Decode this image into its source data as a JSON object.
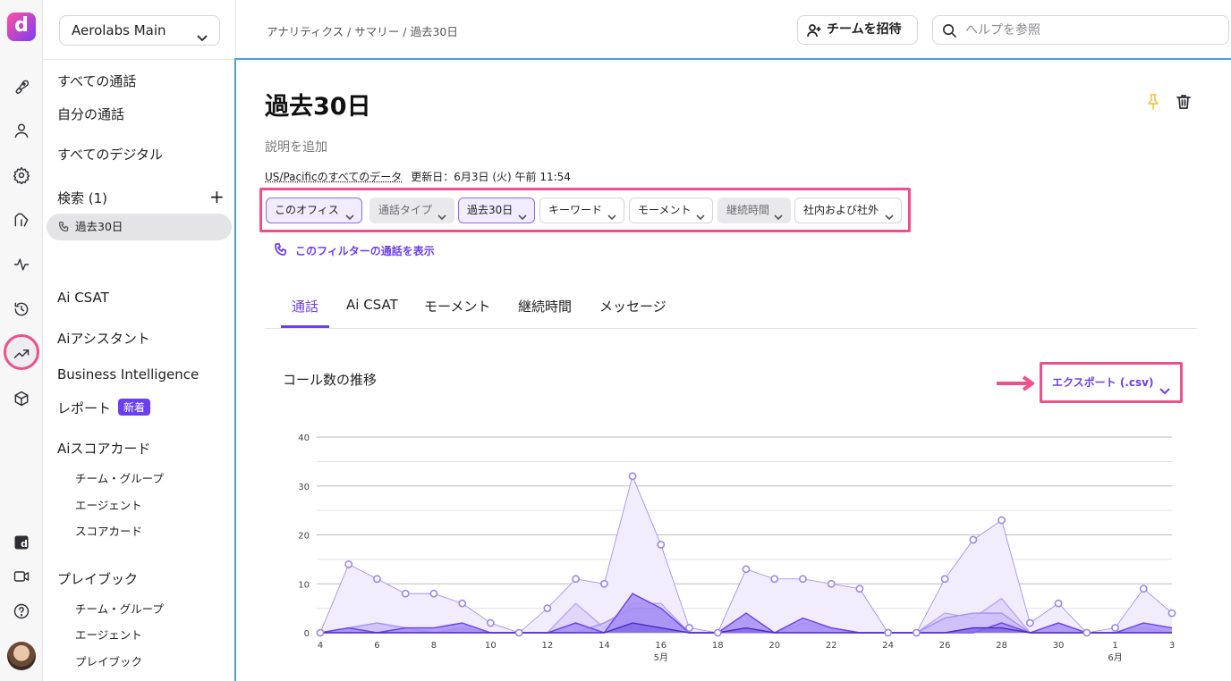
{
  "rail": {
    "logo_letter": "d",
    "icons": [
      "rocket-icon",
      "user-icon",
      "gear-icon",
      "route-icon",
      "activity-icon",
      "history-icon",
      "trending-up-icon",
      "cube-icon",
      "dialpad-logo-icon",
      "video-icon",
      "help-icon",
      "avatar"
    ]
  },
  "sidebar": {
    "workspace": "Aerolabs Main",
    "items": {
      "all_calls": "すべての通話",
      "my_calls": "自分の通話",
      "all_digital": "すべてのデジタル",
      "search": "検索 (1)",
      "saved_search": "過去30日",
      "ai_csat": "Ai CSAT",
      "ai_assistant": "Aiアシスタント",
      "bi": "Business Intelligence",
      "reports": "レポート",
      "reports_badge": "新着",
      "ai_scorecard": "Aiスコアカード",
      "scorecard_team": "チーム・グループ",
      "scorecard_agent": "エージェント",
      "scorecard_card": "スコアカード",
      "playbook": "プレイブック",
      "playbook_team": "チーム・グループ",
      "playbook_agent": "エージェント",
      "playbook_playbook": "プレイブック"
    }
  },
  "topbar": {
    "breadcrumb": "アナリティクス / サマリー / 過去30日",
    "invite_label": "チームを招待",
    "help_placeholder": "ヘルプを参照"
  },
  "main": {
    "title": "過去30日",
    "description": "説明を追加",
    "timezone": "US/Pacificのすべてのデータ",
    "updated": "更新日：6月3日 (火) 午前 11:54",
    "filters": [
      {
        "label": "このオフィス",
        "state": "selected"
      },
      {
        "label": "通話タイプ",
        "state": "disabled"
      },
      {
        "label": "過去30日",
        "state": "selected"
      },
      {
        "label": "キーワード",
        "state": "normal"
      },
      {
        "label": "モーメント",
        "state": "normal"
      },
      {
        "label": "継続時間",
        "state": "disabled"
      },
      {
        "label": "社内および社外",
        "state": "normal"
      }
    ],
    "show_calls": "このフィルターの通話を表示",
    "tabs": [
      "通話",
      "Ai CSAT",
      "モーメント",
      "継続時間",
      "メッセージ"
    ],
    "active_tab": 0,
    "chart_title": "コール数の推移",
    "export_label": "エクスポート (.csv)"
  },
  "colors": {
    "accent": "#6b3ff0",
    "highlight": "#f0508a",
    "pin": "#f2c84b"
  },
  "chart_data": {
    "type": "area",
    "x": [
      "4",
      "5",
      "6",
      "7",
      "8",
      "9",
      "10",
      "11",
      "12",
      "13",
      "14",
      "15",
      "16",
      "17",
      "18",
      "19",
      "20",
      "21",
      "22",
      "23",
      "24",
      "25",
      "26",
      "27",
      "28",
      "29",
      "30",
      "31",
      "1",
      "2",
      "3"
    ],
    "x_tick_labels": [
      "4",
      "6",
      "8",
      "10",
      "12",
      "14",
      "16",
      "18",
      "20",
      "22",
      "24",
      "26",
      "28",
      "30",
      "1",
      "3"
    ],
    "month_labels": [
      {
        "at": "16",
        "label": "5月"
      },
      {
        "at": "1",
        "label": "6月"
      }
    ],
    "ylim": [
      0,
      40
    ],
    "yticks": [
      0,
      10,
      20,
      30,
      40
    ],
    "grid": true,
    "series": [
      {
        "values": [
          0,
          14,
          11,
          8,
          8,
          6,
          2,
          0,
          5,
          11,
          10,
          32,
          18,
          1,
          0,
          13,
          11,
          11,
          10,
          9,
          0,
          0,
          11,
          19,
          23,
          2,
          6,
          0,
          1,
          9,
          4
        ],
        "color": "#9b86ee",
        "fill": "#f1edfd"
      },
      {
        "values": [
          0,
          0,
          0,
          0,
          0,
          0,
          0,
          0,
          0,
          6,
          1,
          6,
          6,
          0,
          0,
          0,
          0,
          0,
          0,
          0,
          0,
          0,
          4,
          3,
          7,
          0,
          0,
          0,
          0,
          1,
          0
        ],
        "color": "#b8a6f2",
        "fill": "#ddd3fb"
      },
      {
        "values": [
          0,
          1,
          2,
          1,
          0,
          1,
          0,
          0,
          0,
          0,
          2,
          5,
          5,
          0,
          0,
          0,
          0,
          2,
          1,
          0,
          0,
          0,
          3,
          4,
          4,
          0,
          0,
          0,
          0,
          0,
          0
        ],
        "color": "#a590f0",
        "fill": "#cbbdf8"
      },
      {
        "values": [
          0,
          1,
          0,
          1,
          1,
          2,
          0,
          0,
          0,
          2,
          0,
          8,
          5,
          0,
          0,
          4,
          0,
          3,
          1,
          0,
          0,
          0,
          0,
          0,
          2,
          0,
          2,
          0,
          0,
          2,
          1
        ],
        "color": "#6b3ff0",
        "fill": "#a68ef3"
      },
      {
        "values": [
          0,
          0,
          0,
          0,
          0,
          0,
          0,
          0,
          0,
          0,
          0,
          2,
          1,
          0,
          0,
          1,
          0,
          0,
          0,
          0,
          0,
          0,
          0,
          1,
          1,
          0,
          0,
          0,
          0,
          0,
          0
        ],
        "color": "#4b2bc0",
        "fill": "#8468e8"
      }
    ]
  }
}
